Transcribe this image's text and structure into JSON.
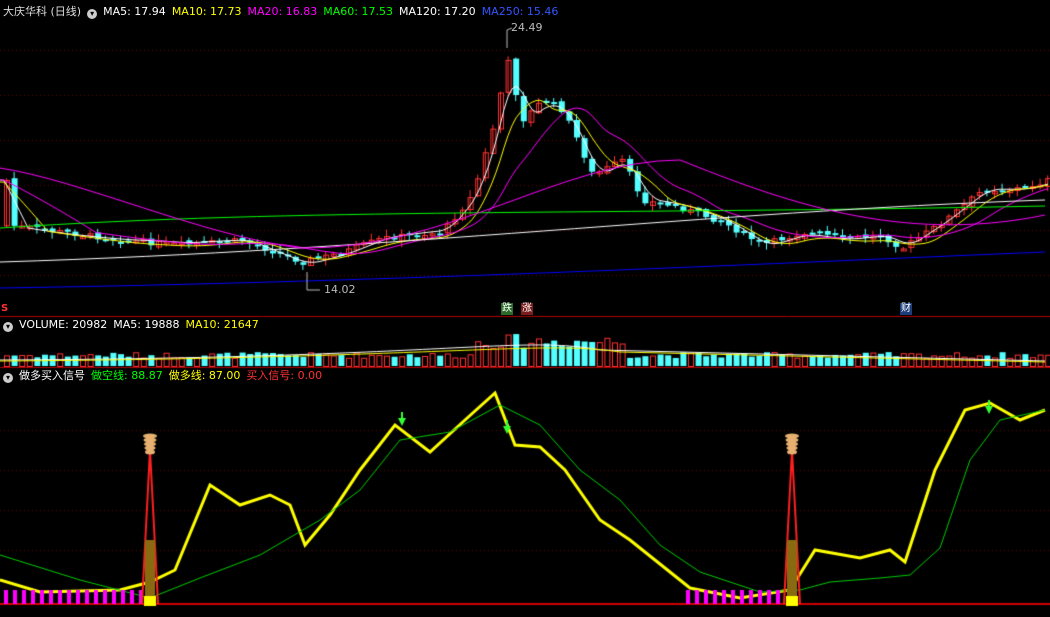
{
  "header": {
    "title": "大庆华科 (日线)",
    "ma5": "MA5: 17.94",
    "ma10": "MA10: 17.73",
    "ma20": "MA20: 16.83",
    "ma60": "MA60: 17.53",
    "ma120": "MA120: 17.20",
    "ma250": "MA250: 15.46"
  },
  "volume_header": {
    "volume": "VOLUME: 20982",
    "ma5": "MA5: 19888",
    "ma10": "MA10: 21647"
  },
  "indicator_header": {
    "name": "做多买入信号",
    "short_line": "做空线: 88.87",
    "long_line": "做多线: 87.00",
    "buy_signal": "买入信号: 0.00"
  },
  "annotations": {
    "high": "24.49",
    "low": "14.02",
    "tag_die": "跌",
    "tag_zhang": "涨",
    "tag_cai": "财",
    "tag_s": "S"
  },
  "colors": {
    "up": "#ff3232",
    "down": "#54ffff",
    "ma5": "#ffffff",
    "ma10": "#ffff00",
    "ma20": "#ff00ff",
    "ma60": "#00ff00",
    "ma120": "#ffffff",
    "ma250": "#0000ff",
    "long_line": "#ffff00",
    "short_line": "#00cc00"
  },
  "icons": {
    "collapse": "chevron-down-icon",
    "buy_marker": "arrow-down-icon",
    "signal_tower": "tower-icon"
  }
}
